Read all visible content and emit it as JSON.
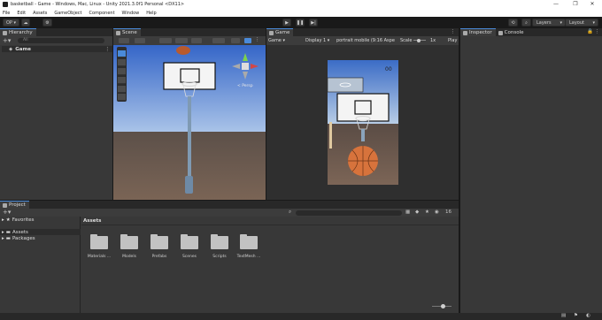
{
  "window": {
    "title": "basketball - Game - Windows, Mac, Linux - Unity 2021.3.0f1 Personal <DX11>",
    "controls": [
      "—",
      "❐",
      "✕"
    ]
  },
  "menu": [
    "File",
    "Edit",
    "Assets",
    "GameObject",
    "Component",
    "Window",
    "Help"
  ],
  "toolbar": {
    "account_label": "OP ▾",
    "layers_label": "Layers",
    "layout_label": "Layout"
  },
  "hierarchy": {
    "tab_label": "Hierarchy",
    "search_placeholder": "All",
    "scene_item": "Game"
  },
  "scene_view": {
    "tab_label": "Scene",
    "persp_label": "< Persp"
  },
  "game_view": {
    "tab_label": "Game",
    "display_dropdown": "Game",
    "display_select": "Display 1",
    "aspect_select": "portrait mobile (9:16 Aspe",
    "scale_label": "Scale",
    "scale_value": "1x",
    "play_label": "Play",
    "score": "00"
  },
  "inspector": {
    "tab_label": "Inspector",
    "console_tab_label": "Console"
  },
  "project": {
    "tab_label": "Project",
    "favorites_label": "Favorites",
    "assets_label": "Assets",
    "packages_label": "Packages",
    "breadcrumb": "Assets",
    "hidden_count": "16",
    "folders": [
      "Materials ...",
      "Models",
      "Prefabs",
      "Scenes",
      "Scripts",
      "TextMesh ..."
    ]
  },
  "colors": {
    "accent": "#4a8ad9",
    "panel": "#383838",
    "dark": "#191919",
    "sky_top": "#2f62c9",
    "ground": "#6e5a4e",
    "ball": "#d7733c"
  }
}
